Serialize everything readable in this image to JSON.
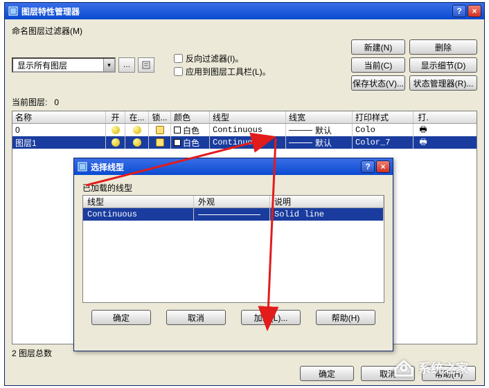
{
  "main": {
    "title": "图层特性管理器",
    "filter_label": "命名图层过滤器(M)",
    "filter_value": "显示所有图层",
    "chk_invert": "反向过滤器(I)。",
    "chk_apply_toolbar": "应用到图层工具栏(L)。",
    "buttons": {
      "new": "新建(N)",
      "delete": "删除",
      "current": "当前(C)",
      "detail": "显示细节(D)",
      "save_state": "保存状态(V)...",
      "state_mgr": "状态管理器(R)..."
    },
    "current_label": "当前图层:",
    "current_value": "0",
    "headers": {
      "name": "名称",
      "on": "开",
      "freeze": "在...",
      "lock": "锁...",
      "color": "颜色",
      "linetype": "线型",
      "lineweight": "线宽",
      "plotstyle": "打印样式",
      "print": "打."
    },
    "rows": [
      {
        "name": "0",
        "color": "白色",
        "lt": "Continuous",
        "lw": "默认",
        "plot": "Colo"
      },
      {
        "name": "图层1",
        "color": "白色",
        "lt": "Continuous",
        "lw": "默认",
        "plot": "Color_7"
      }
    ],
    "status": "2 图层总数",
    "footer": {
      "ok": "确定",
      "cancel": "取消",
      "help": "帮助(H)"
    }
  },
  "sub": {
    "title": "选择线型",
    "loaded_label": "已加载的线型",
    "headers": {
      "name": "线型",
      "appearance": "外观",
      "desc": "说明"
    },
    "row": {
      "name": "Continuous",
      "desc": "Solid line"
    },
    "buttons": {
      "ok": "确定",
      "cancel": "取消",
      "load": "加载(L)...",
      "help": "帮助(H)"
    }
  },
  "watermark": "系统之家"
}
